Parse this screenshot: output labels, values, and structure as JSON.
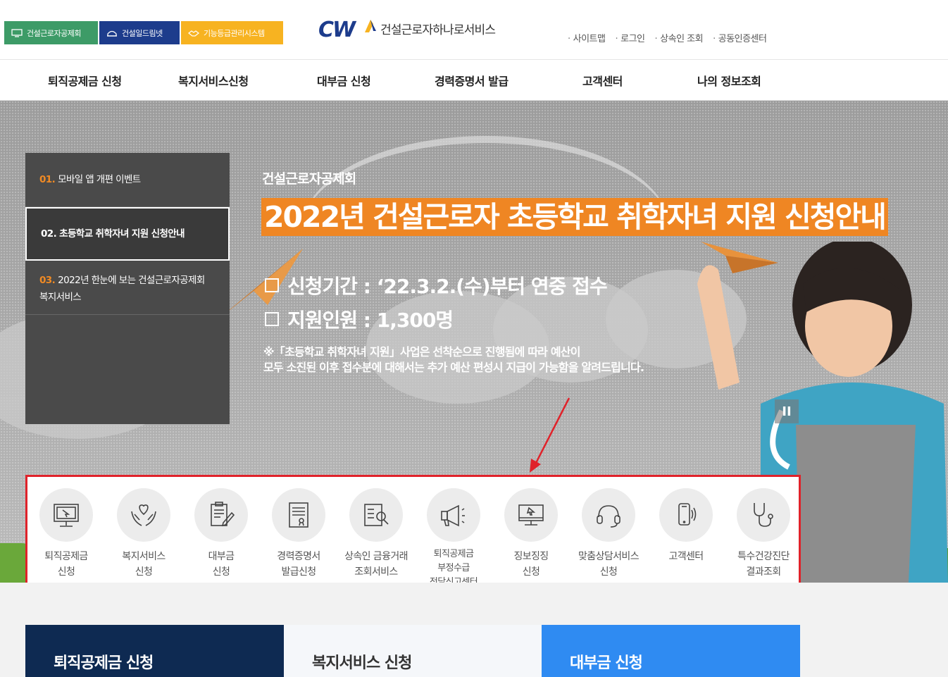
{
  "family_tabs": [
    {
      "label": "건설근로자공제회"
    },
    {
      "label": "건설일드림넷"
    },
    {
      "label": "기능등급관리시스템"
    }
  ],
  "logo": {
    "mark": "CW",
    "text": "건설근로자하나로서비스"
  },
  "util_links": [
    "사이트맵",
    "로그인",
    "상속인 조회",
    "공동인증센터"
  ],
  "gnb": [
    "퇴직공제금 신청",
    "복지서비스신청",
    "대부금 신청",
    "경력증명서 발급",
    "고객센터",
    "나의 정보조회"
  ],
  "slides": [
    {
      "num": "01.",
      "text": "모바일 앱 개편 이벤트"
    },
    {
      "num": "02.",
      "text": "초등학교 취학자녀 지원 신청안내"
    },
    {
      "num": "03.",
      "text": "2022년 한눈에 보는 건설근로자공제회 복지서비스"
    }
  ],
  "hero": {
    "sub": "건설근로자공제회",
    "title": "2022년 건설근로자 초등학교 취학자녀 지원 신청안내",
    "line1": "신청기간 : ‘22.3.2.(수)부터 연중 접수",
    "line2": "지원인원 : 1,300명",
    "note1": "※「초등학교 취학자녀 지원」사업은 선착순으로 진행됨에 따라 예산이",
    "note2": "모두 소진된 이후 접수분에 대해서는 추가 예산 편성시 지급이 가능함을 알려드립니다.",
    "pause": "II"
  },
  "quick": [
    {
      "l1": "퇴직공제금",
      "l2": "신청",
      "icon": "monitor-icon"
    },
    {
      "l1": "복지서비스",
      "l2": "신청",
      "icon": "heart-hands-icon"
    },
    {
      "l1": "대부금",
      "l2": "신청",
      "icon": "document-pen-icon"
    },
    {
      "l1": "경력증명서",
      "l2": "발급신청",
      "icon": "certificate-icon"
    },
    {
      "l1": "상속인 금융거래",
      "l2": "조회서비스",
      "icon": "document-search-icon"
    },
    {
      "l1": "퇴직공제금",
      "l2": "부정수급",
      "l3": "전담신고센터",
      "icon": "megaphone-icon"
    },
    {
      "l1": "징보징징",
      "l2": "신청",
      "icon": "computer-cursor-icon"
    },
    {
      "l1": "맞춤상담서비스",
      "l2": "신청",
      "icon": "headset-icon"
    },
    {
      "l1": "고객센터",
      "l2": "",
      "icon": "phone-icon"
    },
    {
      "l1": "특수건강진단",
      "l2": "결과조회",
      "icon": "stethoscope-icon"
    }
  ],
  "cards": [
    "퇴직공제금 신청",
    "복지서비스 신청",
    "대부금 신청"
  ],
  "colors": {
    "accent_orange": "#ef8623",
    "navy": "#0e2a52",
    "blue": "#2f8bf2",
    "highlight_red": "#e0222a"
  }
}
